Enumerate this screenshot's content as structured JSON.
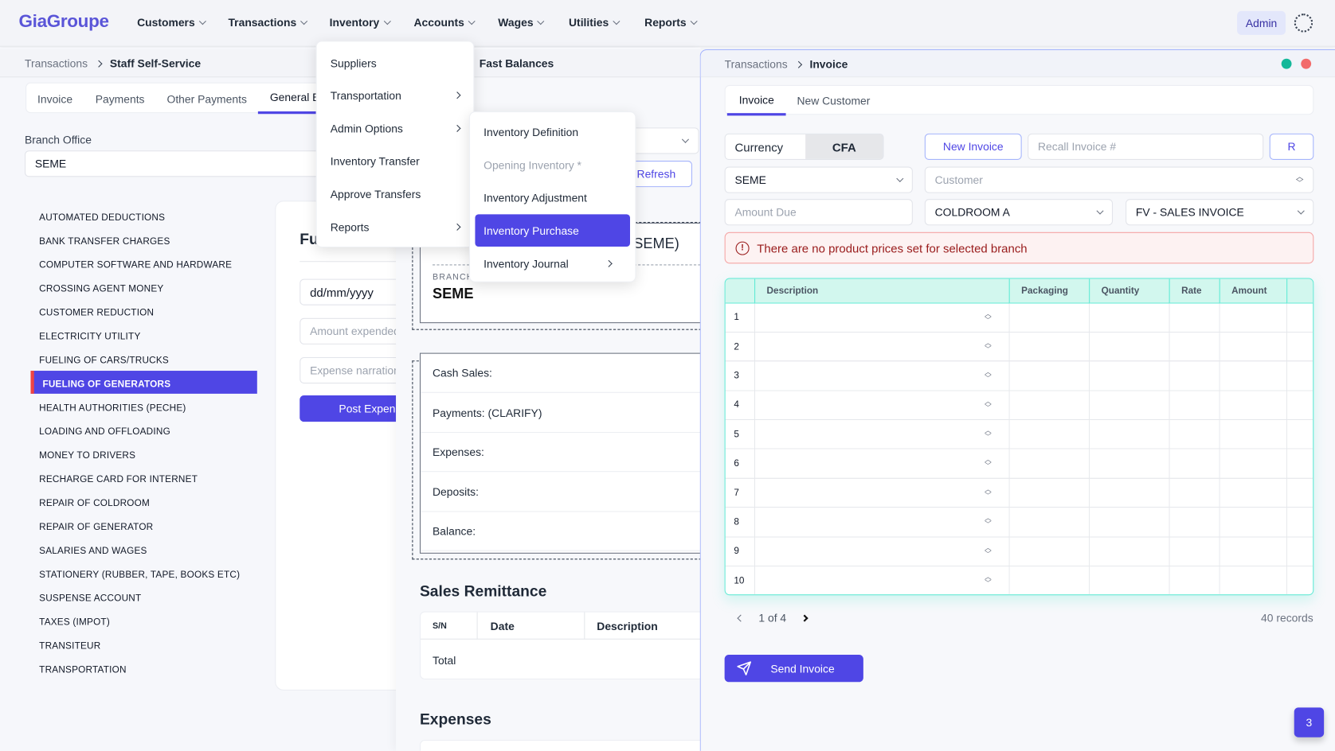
{
  "app": {
    "logo": "GiaGroupe",
    "nav": [
      "Customers",
      "Transactions",
      "Inventory",
      "Accounts",
      "Wages",
      "Utilities",
      "Reports"
    ],
    "admin": "Admin"
  },
  "left": {
    "breadcrumb": [
      "Transactions",
      "Staff Self-Service"
    ],
    "tabs": [
      "Invoice",
      "Payments",
      "Other Payments",
      "General E"
    ],
    "branch_label": "Branch Office",
    "branch_value": "SEME",
    "categories": [
      "AUTOMATED DEDUCTIONS",
      "BANK TRANSFER CHARGES",
      "COMPUTER SOFTWARE AND HARDWARE",
      "CROSSING AGENT MONEY",
      "CUSTOMER REDUCTION",
      "ELECTRICITY UTILITY",
      "FUELING OF CARS/TRUCKS",
      "FUELING OF GENERATORS",
      "HEALTH AUTHORITIES (PECHE)",
      "LOADING AND OFFLOADING",
      "MONEY TO DRIVERS",
      "RECHARGE CARD FOR INTERNET",
      "REPAIR OF COLDROOM",
      "REPAIR OF GENERATOR",
      "SALARIES AND WAGES",
      "STATIONERY (RUBBER, TAPE, BOOKS ETC)",
      "SUSPENSE ACCOUNT",
      "TAXES (IMPOT)",
      "TRANSITEUR",
      "TRANSPORTATION"
    ],
    "selected_category": "FUELING OF GENERATORS",
    "form": {
      "title": "Fu",
      "date_placeholder": "dd/mm/yyyy",
      "amount_placeholder": "Amount expended",
      "narration_placeholder": "Expense narration",
      "post": "Post Expense"
    }
  },
  "middle": {
    "title": "Fast Balances",
    "refresh": "Refresh",
    "summary_suffix": "SEME)",
    "branch_label": "BRANCH",
    "branch_value": "SEME",
    "balances": [
      "Cash Sales:",
      "Payments: (CLARIFY)",
      "Expenses:",
      "Deposits:",
      "Balance:"
    ],
    "remittance_title": "Sales Remittance",
    "remittance_cols": [
      "S/N",
      "Date",
      "Description"
    ],
    "total": "Total",
    "expenses_title": "Expenses"
  },
  "inventory_menu": {
    "items": [
      {
        "label": "Suppliers"
      },
      {
        "label": "Transportation",
        "sub": true
      },
      {
        "label": "Admin Options",
        "sub": true
      },
      {
        "label": "Inventory Transfer"
      },
      {
        "label": "Approve Transfers"
      },
      {
        "label": "Reports",
        "sub": true
      }
    ]
  },
  "submenu": {
    "items": [
      {
        "label": "Inventory Definition"
      },
      {
        "label": "Opening Inventory *",
        "disabled": true
      },
      {
        "label": "Inventory Adjustment"
      },
      {
        "label": "Inventory Purchase",
        "active": true
      },
      {
        "label": "Inventory Journal",
        "sub": true
      }
    ]
  },
  "invoice": {
    "breadcrumb": [
      "Transactions",
      "Invoice"
    ],
    "tabs": [
      "Invoice",
      "New Customer"
    ],
    "currency_label": "Currency",
    "currency_value": "CFA",
    "new_invoice": "New Invoice",
    "recall_placeholder": "Recall Invoice #",
    "recall_button": "R",
    "branch": "SEME",
    "customer_placeholder": "Customer",
    "amount_placeholder": "Amount Due",
    "store": "COLDROOM A",
    "invoice_type": "FV - SALES INVOICE",
    "alert": "There are no product prices set for selected branch",
    "columns": [
      "",
      "Description",
      "Packaging",
      "Quantity",
      "Rate",
      "Amount",
      ""
    ],
    "rows": [
      "1",
      "2",
      "3",
      "4",
      "5",
      "6",
      "7",
      "8",
      "9",
      "10"
    ],
    "pagination": "1 of 4",
    "records": "40 records",
    "send": "Send Invoice",
    "fab": "3"
  },
  "colors": {
    "accent": "#4f46e5",
    "table_border": "#5eead4",
    "alert_bg": "#fdf2f2",
    "alert_text": "#991b1b",
    "dot_green": "#10b981",
    "dot_red": "#f87171"
  }
}
